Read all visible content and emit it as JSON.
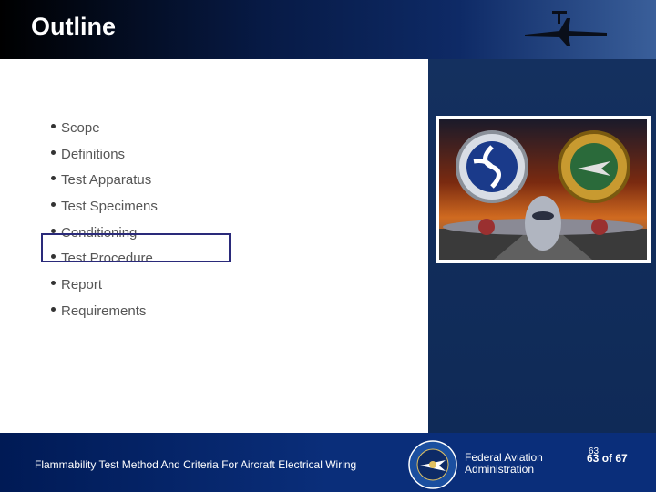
{
  "header": {
    "title": "Outline"
  },
  "bullets": [
    "Scope",
    "Definitions",
    "Test Apparatus",
    "Test Specimens",
    "Conditioning",
    "Test Procedure",
    "Report",
    "Requirements"
  ],
  "footer": {
    "document_title": "Flammability Test Method And Criteria For Aircraft Electrical Wiring",
    "agency_line1": "Federal Aviation",
    "agency_line2": "Administration",
    "page_current_shadow": "63",
    "page_current": "63",
    "page_of": "of 67"
  },
  "colors": {
    "header_bg": "#071a45",
    "footer_bg": "#0a2e7a",
    "panel_bg": "#14305f",
    "highlight_border": "#2a2a7a"
  },
  "icons": [
    "airplane-silhouette-icon",
    "dot-seal-icon",
    "faa-seal-icon",
    "jet-front-icon",
    "faa-logo-icon"
  ]
}
